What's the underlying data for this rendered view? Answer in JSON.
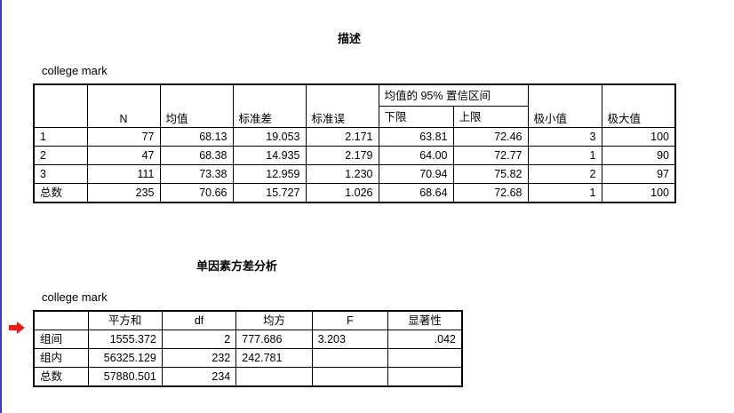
{
  "descriptives": {
    "title": "描述",
    "caption": "college mark",
    "headers": {
      "n": "N",
      "mean": "均值",
      "sd": "标准差",
      "se": "标准误",
      "ci": "均值的 95% 置信区间",
      "lower": "下限",
      "upper": "上限",
      "min": "极小值",
      "max": "极大值"
    },
    "rows": [
      {
        "label": "1",
        "n": "77",
        "mean": "68.13",
        "sd": "19.053",
        "se": "2.171",
        "lower": "63.81",
        "upper": "72.46",
        "min": "3",
        "max": "100"
      },
      {
        "label": "2",
        "n": "47",
        "mean": "68.38",
        "sd": "14.935",
        "se": "2.179",
        "lower": "64.00",
        "upper": "72.77",
        "min": "1",
        "max": "90"
      },
      {
        "label": "3",
        "n": "111",
        "mean": "73.38",
        "sd": "12.959",
        "se": "1.230",
        "lower": "70.94",
        "upper": "75.82",
        "min": "2",
        "max": "97"
      },
      {
        "label": "总数",
        "n": "235",
        "mean": "70.66",
        "sd": "15.727",
        "se": "1.026",
        "lower": "68.64",
        "upper": "72.68",
        "min": "1",
        "max": "100"
      }
    ]
  },
  "anova": {
    "title": "单因素方差分析",
    "caption": "college mark",
    "headers": {
      "ss": "平方和",
      "df": "df",
      "ms": "均方",
      "f": "F",
      "sig": "显著性"
    },
    "rows": [
      {
        "label": "组间",
        "ss": "1555.372",
        "df": "2",
        "ms": "777.686",
        "f": "3.203",
        "sig": ".042"
      },
      {
        "label": "组内",
        "ss": "56325.129",
        "df": "232",
        "ms": "242.781",
        "f": "",
        "sig": ""
      },
      {
        "label": "总数",
        "ss": "57880.501",
        "df": "234",
        "ms": "",
        "f": "",
        "sig": ""
      }
    ]
  },
  "colors": {
    "arrow": "#ee1c1c",
    "left_border": "#3a3ad0"
  },
  "icons": {
    "marker": "arrow-right-icon"
  }
}
